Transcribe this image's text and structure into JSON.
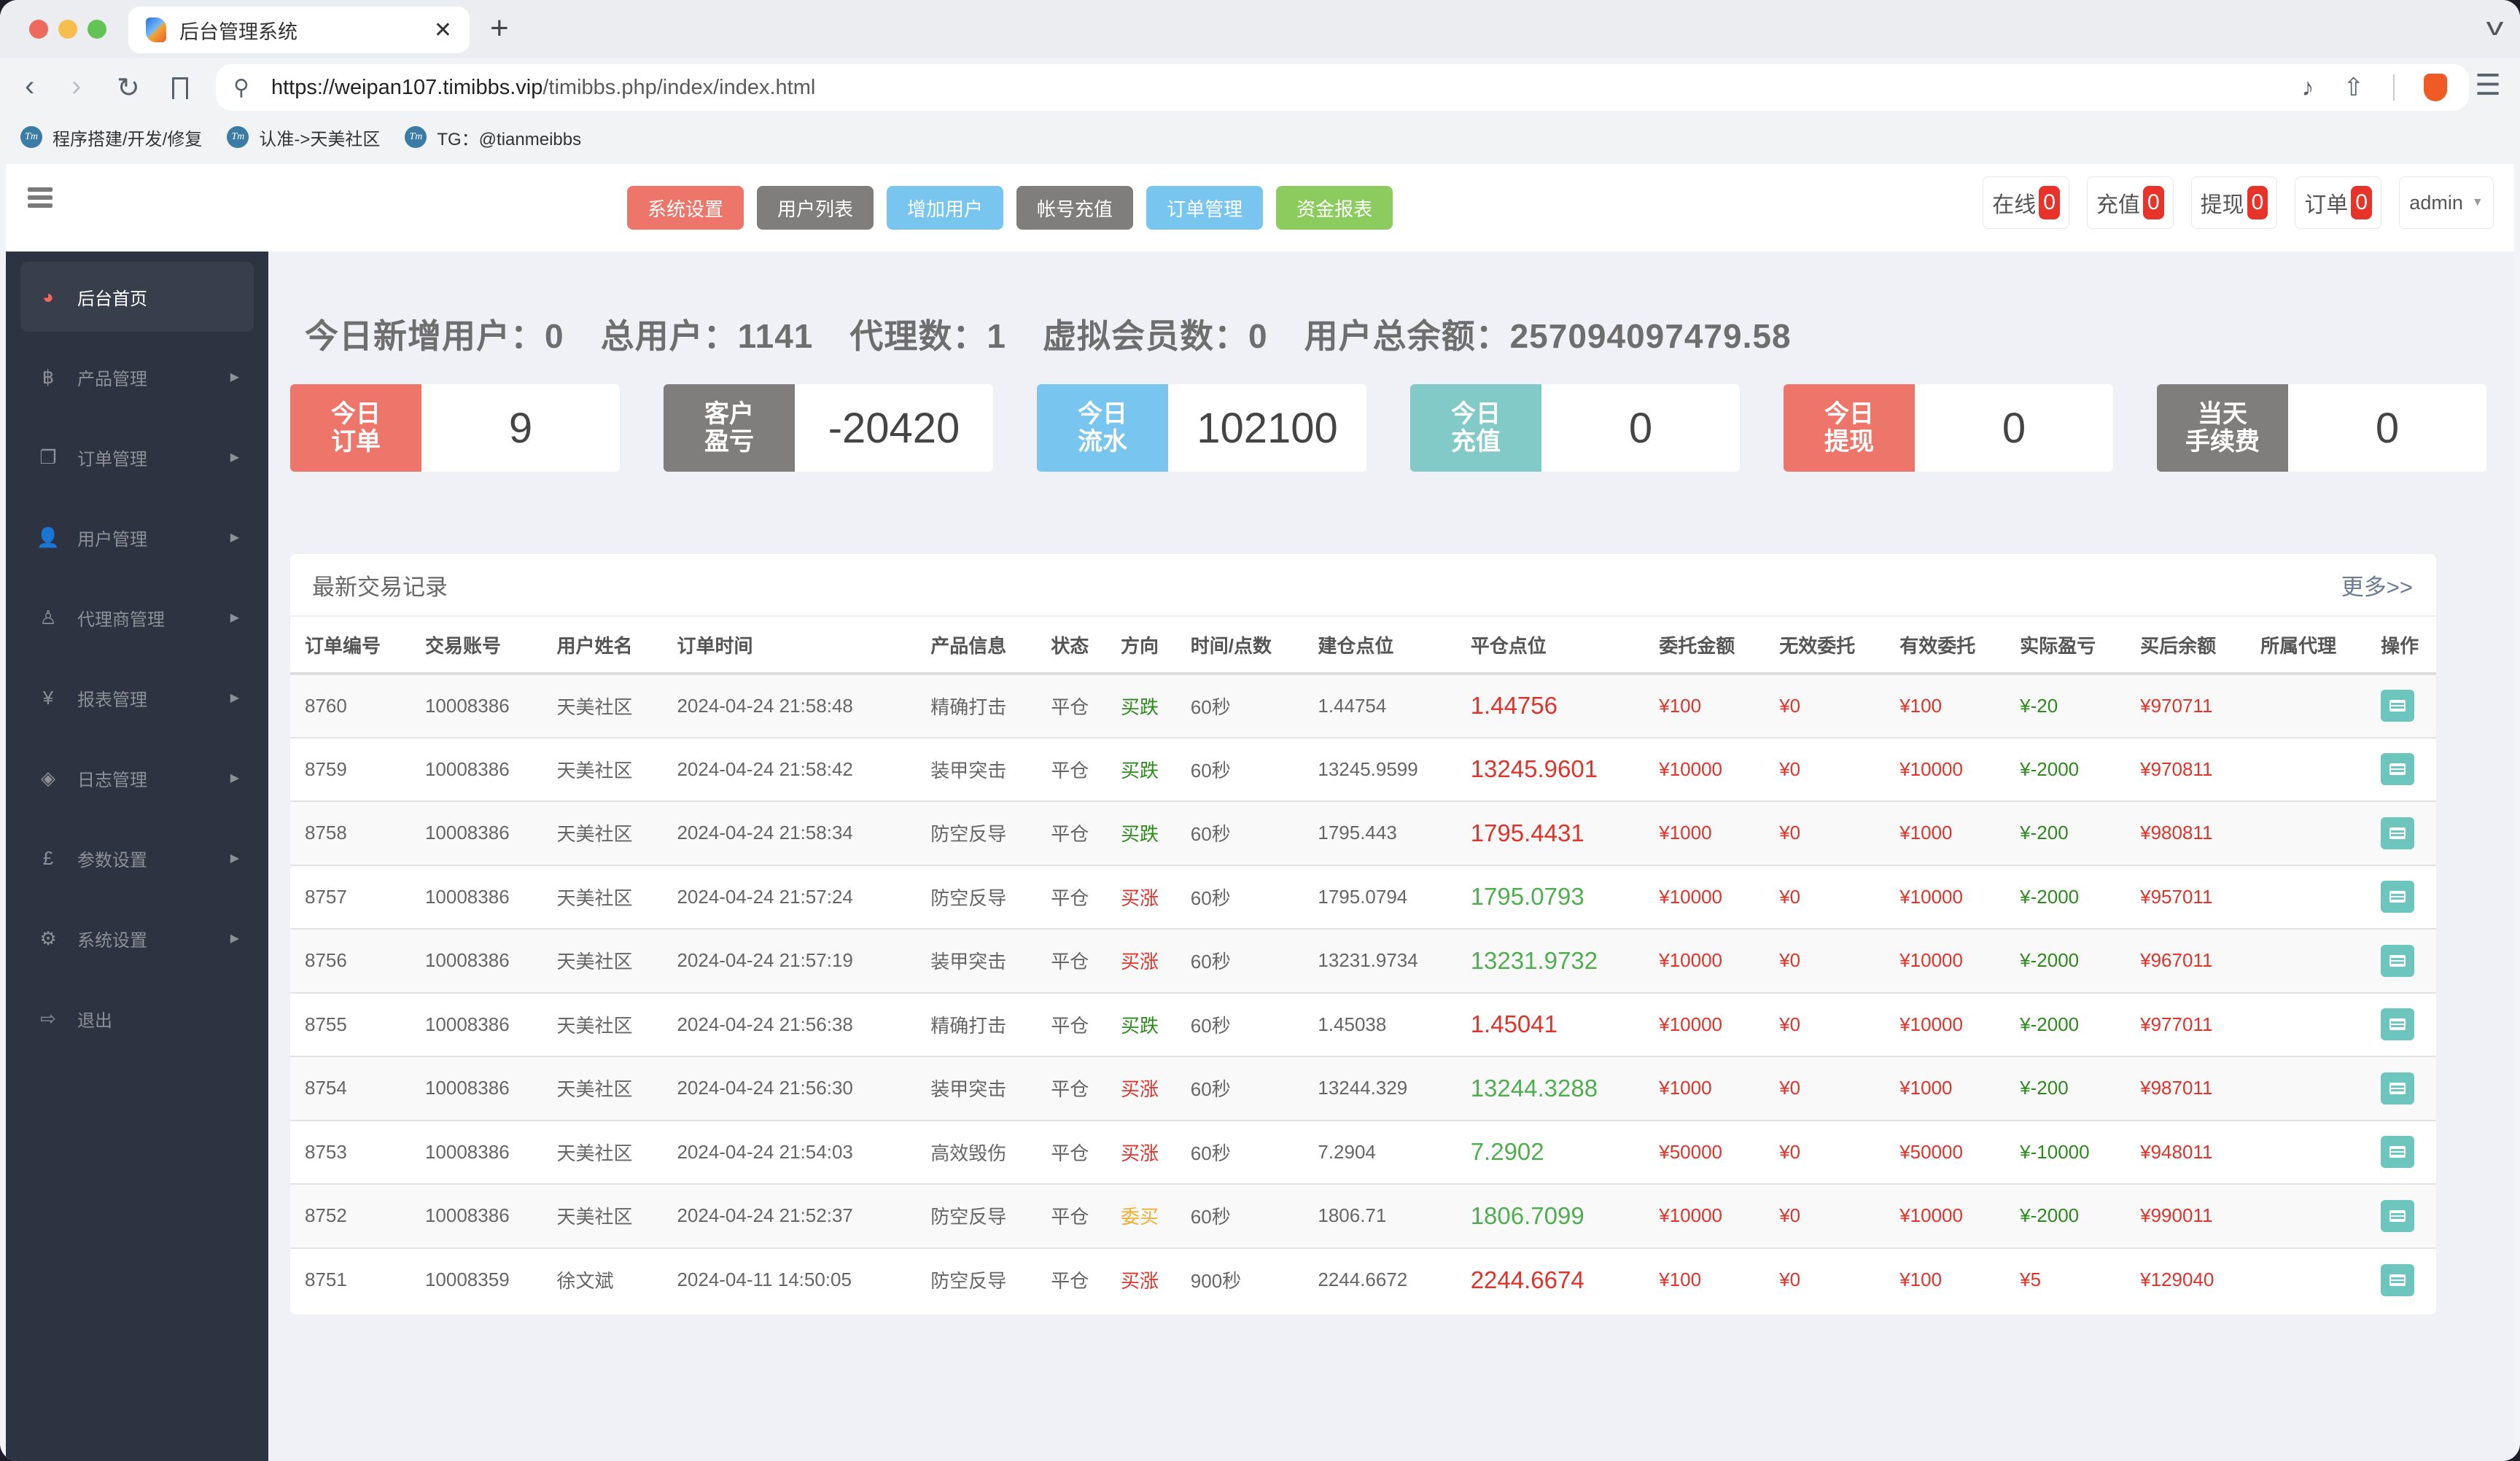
{
  "browser": {
    "tab_title": "后台管理系统",
    "url_host": "https://weipan107.timibbs.vip",
    "url_path": "/timibbs.php/index/index.html",
    "bookmarks": [
      {
        "label": "程序搭建/开发/修复"
      },
      {
        "label": "认准->天美社区"
      },
      {
        "label": "TG：@tianmeibbs"
      }
    ]
  },
  "topnav": [
    {
      "label": "系统设置",
      "color": "#ee7569"
    },
    {
      "label": "用户列表",
      "color": "#807e7c"
    },
    {
      "label": "增加用户",
      "color": "#78c5ef"
    },
    {
      "label": "帐号充值",
      "color": "#807e7c"
    },
    {
      "label": "订单管理",
      "color": "#78c5ef"
    },
    {
      "label": "资金报表",
      "color": "#8ccc5e"
    }
  ],
  "badges": [
    {
      "label": "在线",
      "count": "0"
    },
    {
      "label": "充值",
      "count": "0"
    },
    {
      "label": "提现",
      "count": "0"
    },
    {
      "label": "订单",
      "count": "0"
    }
  ],
  "admin": {
    "label": "admin"
  },
  "sidebar": {
    "items": [
      {
        "label": "后台首页",
        "icon": "dashboard-icon",
        "glyph": "◕",
        "active": true,
        "arrow": false
      },
      {
        "label": "产品管理",
        "icon": "bitcoin-icon",
        "glyph": "฿",
        "arrow": true
      },
      {
        "label": "订单管理",
        "icon": "files-icon",
        "glyph": "❐",
        "arrow": true
      },
      {
        "label": "用户管理",
        "icon": "user-icon",
        "glyph": "👤",
        "arrow": true
      },
      {
        "label": "代理商管理",
        "icon": "user-secret-icon",
        "glyph": "♙",
        "arrow": true
      },
      {
        "label": "报表管理",
        "icon": "yen-icon",
        "glyph": "¥",
        "arrow": true
      },
      {
        "label": "日志管理",
        "icon": "ticket-icon",
        "glyph": "◈",
        "arrow": true
      },
      {
        "label": "参数设置",
        "icon": "pound-icon",
        "glyph": "£",
        "arrow": true
      },
      {
        "label": "系统设置",
        "icon": "gears-icon",
        "glyph": "⚙",
        "arrow": true
      },
      {
        "label": "退出",
        "icon": "sign-out-icon",
        "glyph": "⇨",
        "arrow": false
      }
    ]
  },
  "stats": {
    "new_users": "今日新增用户：0",
    "total_users": "总用户：1141",
    "agents": "代理数：1",
    "virtual_members": "虚拟会员数：0",
    "total_balance": "用户总余额：257094097479.58"
  },
  "cards": [
    {
      "label": "今日\n订单",
      "value": "9",
      "color": "#ee7569"
    },
    {
      "label": "客户\n盈亏",
      "value": "-20420",
      "color": "#807e7c"
    },
    {
      "label": "今日\n流水",
      "value": "102100",
      "color": "#78c5ef"
    },
    {
      "label": "今日\n充值",
      "value": "0",
      "color": "#82cac8"
    },
    {
      "label": "今日\n提现",
      "value": "0",
      "color": "#ee7569"
    },
    {
      "label": "当天\n手续费",
      "value": "0",
      "color": "#807e7c"
    }
  ],
  "trades": {
    "title": "最新交易记录",
    "more": "更多>>",
    "columns": [
      "订单编号",
      "交易账号",
      "用户姓名",
      "订单时间",
      "产品信息",
      "状态",
      "方向",
      "时间/点数",
      "建仓点位",
      "平仓点位",
      "委托金额",
      "无效委托",
      "有效委托",
      "实际盈亏",
      "买后余额",
      "所属代理",
      "操作"
    ],
    "rows": [
      {
        "id": "8760",
        "account": "10008386",
        "name": "天美社区",
        "time": "2024-04-24 21:58:48",
        "product": "精确打击",
        "status": "平仓",
        "direction": "买跌",
        "dir_color": "green",
        "duration": "60秒",
        "open": "1.44754",
        "close": "1.44756",
        "close_color": "red",
        "amount": "¥100",
        "invalid": "¥0",
        "valid": "¥100",
        "pnl": "¥-20",
        "pnl_color": "green",
        "balance": "¥970711",
        "agent": ""
      },
      {
        "id": "8759",
        "account": "10008386",
        "name": "天美社区",
        "time": "2024-04-24 21:58:42",
        "product": "装甲突击",
        "status": "平仓",
        "direction": "买跌",
        "dir_color": "green",
        "duration": "60秒",
        "open": "13245.9599",
        "close": "13245.9601",
        "close_color": "red",
        "amount": "¥10000",
        "invalid": "¥0",
        "valid": "¥10000",
        "pnl": "¥-2000",
        "pnl_color": "green",
        "balance": "¥970811",
        "agent": ""
      },
      {
        "id": "8758",
        "account": "10008386",
        "name": "天美社区",
        "time": "2024-04-24 21:58:34",
        "product": "防空反导",
        "status": "平仓",
        "direction": "买跌",
        "dir_color": "green",
        "duration": "60秒",
        "open": "1795.443",
        "close": "1795.4431",
        "close_color": "red",
        "amount": "¥1000",
        "invalid": "¥0",
        "valid": "¥1000",
        "pnl": "¥-200",
        "pnl_color": "green",
        "balance": "¥980811",
        "agent": ""
      },
      {
        "id": "8757",
        "account": "10008386",
        "name": "天美社区",
        "time": "2024-04-24 21:57:24",
        "product": "防空反导",
        "status": "平仓",
        "direction": "买涨",
        "dir_color": "red",
        "duration": "60秒",
        "open": "1795.0794",
        "close": "1795.0793",
        "close_color": "lgreen",
        "amount": "¥10000",
        "invalid": "¥0",
        "valid": "¥10000",
        "pnl": "¥-2000",
        "pnl_color": "green",
        "balance": "¥957011",
        "agent": ""
      },
      {
        "id": "8756",
        "account": "10008386",
        "name": "天美社区",
        "time": "2024-04-24 21:57:19",
        "product": "装甲突击",
        "status": "平仓",
        "direction": "买涨",
        "dir_color": "red",
        "duration": "60秒",
        "open": "13231.9734",
        "close": "13231.9732",
        "close_color": "lgreen",
        "amount": "¥10000",
        "invalid": "¥0",
        "valid": "¥10000",
        "pnl": "¥-2000",
        "pnl_color": "green",
        "balance": "¥967011",
        "agent": ""
      },
      {
        "id": "8755",
        "account": "10008386",
        "name": "天美社区",
        "time": "2024-04-24 21:56:38",
        "product": "精确打击",
        "status": "平仓",
        "direction": "买跌",
        "dir_color": "green",
        "duration": "60秒",
        "open": "1.45038",
        "close": "1.45041",
        "close_color": "red",
        "amount": "¥10000",
        "invalid": "¥0",
        "valid": "¥10000",
        "pnl": "¥-2000",
        "pnl_color": "green",
        "balance": "¥977011",
        "agent": ""
      },
      {
        "id": "8754",
        "account": "10008386",
        "name": "天美社区",
        "time": "2024-04-24 21:56:30",
        "product": "装甲突击",
        "status": "平仓",
        "direction": "买涨",
        "dir_color": "red",
        "duration": "60秒",
        "open": "13244.329",
        "close": "13244.3288",
        "close_color": "lgreen",
        "amount": "¥1000",
        "invalid": "¥0",
        "valid": "¥1000",
        "pnl": "¥-200",
        "pnl_color": "green",
        "balance": "¥987011",
        "agent": ""
      },
      {
        "id": "8753",
        "account": "10008386",
        "name": "天美社区",
        "time": "2024-04-24 21:54:03",
        "product": "高效毁伤",
        "status": "平仓",
        "direction": "买涨",
        "dir_color": "red",
        "duration": "60秒",
        "open": "7.2904",
        "close": "7.2902",
        "close_color": "lgreen",
        "amount": "¥50000",
        "invalid": "¥0",
        "valid": "¥50000",
        "pnl": "¥-10000",
        "pnl_color": "green",
        "balance": "¥948011",
        "agent": ""
      },
      {
        "id": "8752",
        "account": "10008386",
        "name": "天美社区",
        "time": "2024-04-24 21:52:37",
        "product": "防空反导",
        "status": "平仓",
        "direction": "委买",
        "dir_color": "orange",
        "duration": "60秒",
        "open": "1806.71",
        "close": "1806.7099",
        "close_color": "lgreen",
        "amount": "¥10000",
        "invalid": "¥0",
        "valid": "¥10000",
        "pnl": "¥-2000",
        "pnl_color": "green",
        "balance": "¥990011",
        "agent": ""
      },
      {
        "id": "8751",
        "account": "10008359",
        "name": "徐文斌",
        "time": "2024-04-11 14:50:05",
        "product": "防空反导",
        "status": "平仓",
        "direction": "买涨",
        "dir_color": "red",
        "duration": "900秒",
        "open": "2244.6672",
        "close": "2244.6674",
        "close_color": "red",
        "amount": "¥100",
        "invalid": "¥0",
        "valid": "¥100",
        "pnl": "¥5",
        "pnl_color": "red",
        "balance": "¥129040",
        "agent": ""
      }
    ]
  }
}
